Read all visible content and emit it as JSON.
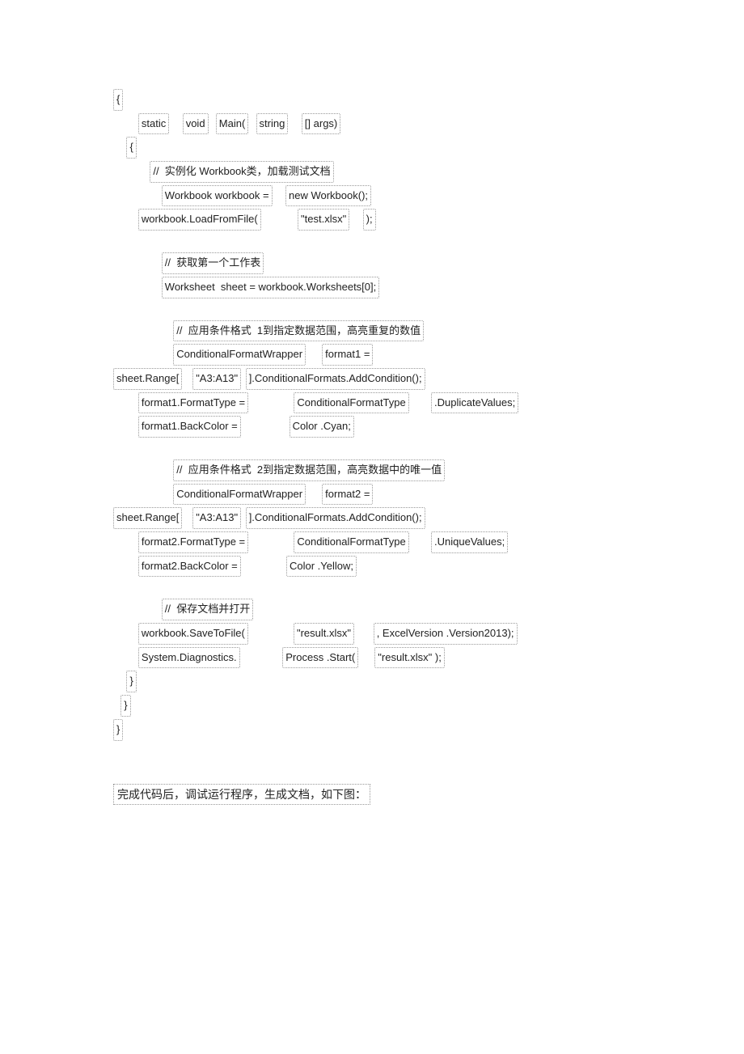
{
  "c1": {
    "brace": "{"
  },
  "c2": {
    "indent": "        ",
    "t1": "static",
    "sp1": "    ",
    "t2": "void",
    "sp2": "  ",
    "t3": "Main(",
    "sp3": "  ",
    "t4": "string",
    "sp4": "    ",
    "t5": "[] args)"
  },
  "c3": {
    "indent": "    ",
    "brace": "{"
  },
  "c4": {
    "indent": "            ",
    "cmt": "//  实例化 Workbook类，加载测试文档"
  },
  "c5": {
    "indent": "                ",
    "t1": "Workbook workbook =",
    "sp1": "    ",
    "t2": "new Workbook();"
  },
  "c6": {
    "indent": "        ",
    "t1": "workbook.LoadFromFile(",
    "sp1": "            ",
    "t2": "\"test.xlsx\"",
    "sp2": "    ",
    "t3": ");"
  },
  "c7": {
    "indent": "                ",
    "cmt": "//  获取第一个工作表"
  },
  "c8": {
    "indent": "                ",
    "t1": "Worksheet  sheet = workbook.Worksheets[0];"
  },
  "c9": {
    "indent": "                    ",
    "cmt": "//  应用条件格式  1到指定数据范围，高亮重复的数值"
  },
  "c10": {
    "indent": "                    ",
    "t1": "ConditionalFormatWrapper",
    "sp1": "     ",
    "t2": "format1 ="
  },
  "c11": {
    "t1": "sheet.Range[",
    "sp1": "   ",
    "t2": "\"A3:A13\"",
    "sp2": " ",
    "t3": "].ConditionalFormats.AddCondition();"
  },
  "c12": {
    "indent": "        ",
    "t1": "format1.FormatType =",
    "sp1": "               ",
    "t2": "ConditionalFormatType",
    "sp2": "       ",
    "t3": ".DuplicateValues;"
  },
  "c13": {
    "indent": "        ",
    "t1": "format1.BackColor =",
    "sp1": "                ",
    "t2": "Color .Cyan;"
  },
  "c14": {
    "indent": "                    ",
    "cmt": "//  应用条件格式  2到指定数据范围，高亮数据中的唯一值"
  },
  "c15": {
    "indent": "                    ",
    "t1": "ConditionalFormatWrapper",
    "sp1": "     ",
    "t2": "format2 ="
  },
  "c16": {
    "t1": "sheet.Range[",
    "sp1": "   ",
    "t2": "\"A3:A13\"",
    "sp2": " ",
    "t3": "].ConditionalFormats.AddCondition();"
  },
  "c17": {
    "indent": "        ",
    "t1": "format2.FormatType =",
    "sp1": "               ",
    "t2": "ConditionalFormatType",
    "sp2": "       ",
    "t3": ".UniqueValues;"
  },
  "c18": {
    "indent": "        ",
    "t1": "format2.BackColor =",
    "sp1": "               ",
    "t2": "Color .Yellow;"
  },
  "c19": {
    "indent": "                ",
    "cmt": "//  保存文档并打开"
  },
  "c20": {
    "indent": "        ",
    "t1": "workbook.SaveToFile(",
    "sp1": "               ",
    "t2": "\"result.xlsx\"",
    "sp2": "      ",
    "t3": ", ExcelVersion .Version2013);"
  },
  "c21": {
    "indent": "        ",
    "t1": "System.Diagnostics.",
    "sp1": "              ",
    "t2": "Process .Start(",
    "sp2": "     ",
    "t3": "\"result.xlsx\" );"
  },
  "c22": {
    "indent": "    ",
    "brace": "}"
  },
  "c23": {
    "indent": "  ",
    "brace": "}"
  },
  "c24": {
    "brace": "}"
  },
  "footer": "完成代码后，调试运行程序，生成文档，如下图："
}
